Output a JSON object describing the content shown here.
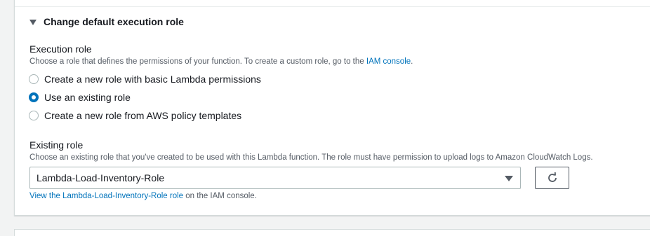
{
  "expander": {
    "title": "Change default execution role"
  },
  "execution_role": {
    "label": "Execution role",
    "description_prefix": "Choose a role that defines the permissions of your function. To create a custom role, go to the ",
    "description_link": "IAM console",
    "description_suffix": ".",
    "options": [
      {
        "label": "Create a new role with basic Lambda permissions",
        "checked": false
      },
      {
        "label": "Use an existing role",
        "checked": true
      },
      {
        "label": "Create a new role from AWS policy templates",
        "checked": false
      }
    ]
  },
  "existing_role": {
    "label": "Existing role",
    "description": "Choose an existing role that you've created to be used with this Lambda function. The role must have permission to upload logs to Amazon CloudWatch Logs.",
    "selected_value": "Lambda-Load-Inventory-Role",
    "view_link": "View the Lambda-Load-Inventory-Role role",
    "view_suffix": " on the IAM console."
  },
  "icons": {
    "expander": "caret-down-icon",
    "select": "dropdown-caret-icon",
    "refresh": "refresh-icon"
  },
  "colors": {
    "link": "#0073bb",
    "radio_selected": "#0073bb",
    "panel_border": "#d5dbdb",
    "background": "#f2f3f3"
  }
}
